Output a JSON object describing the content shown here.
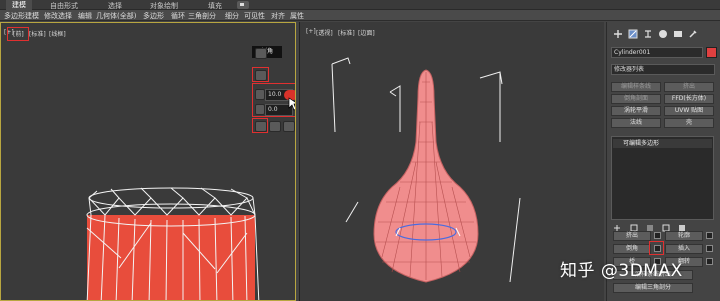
{
  "ribbon": {
    "tabs": [
      "建模",
      "自由形式",
      "选择",
      "对象绘制",
      "填充"
    ]
  },
  "sub_toolbar": {
    "items": [
      "多边形建模",
      "修改选择",
      "编辑",
      "几何体(全部)",
      "多边形",
      "循环",
      "三角剖分",
      "细分",
      "可见性",
      "对齐",
      "属性"
    ]
  },
  "left_viewport": {
    "labels": [
      "[+]",
      "[前]",
      "[标准]",
      "[线框]"
    ]
  },
  "right_viewport": {
    "labels": [
      "[+]",
      "[透视]",
      "[标准]",
      "[边面]"
    ]
  },
  "caddy": {
    "title": "倒角",
    "height_value": "10.0",
    "outline_value": "0.0"
  },
  "command_panel": {
    "object_name": "Cylinder001",
    "modifier_list": "修改器列表",
    "buttons": [
      {
        "label": "编辑样条线",
        "dim": true
      },
      {
        "label": "挤出",
        "dim": true
      },
      {
        "label": "倒角剖面",
        "dim": true
      },
      {
        "label": "FFD(长方体)",
        "dim": false
      },
      {
        "label": "涡轮平滑",
        "dim": false
      },
      {
        "label": "UVW 贴图",
        "dim": false
      },
      {
        "label": "法线",
        "dim": false
      },
      {
        "label": "壳",
        "dim": false
      }
    ],
    "stack_item": "可编辑多边形",
    "poly_buttons": [
      {
        "label": "挤出"
      },
      {
        "label": "轮廓"
      },
      {
        "label": "倒角"
      },
      {
        "label": "插入"
      },
      {
        "label": "桥"
      },
      {
        "label": "翻转"
      },
      {
        "label": "沿样条线挤出"
      },
      {
        "label": "编辑三角剖分"
      }
    ]
  },
  "watermark": "知乎 @3DMAX",
  "colors": {
    "highlight_red": "#e03030",
    "mesh_red": "#e84d3c",
    "viewport_bg": "#3a3a3a",
    "active_border": "#b8a640"
  }
}
